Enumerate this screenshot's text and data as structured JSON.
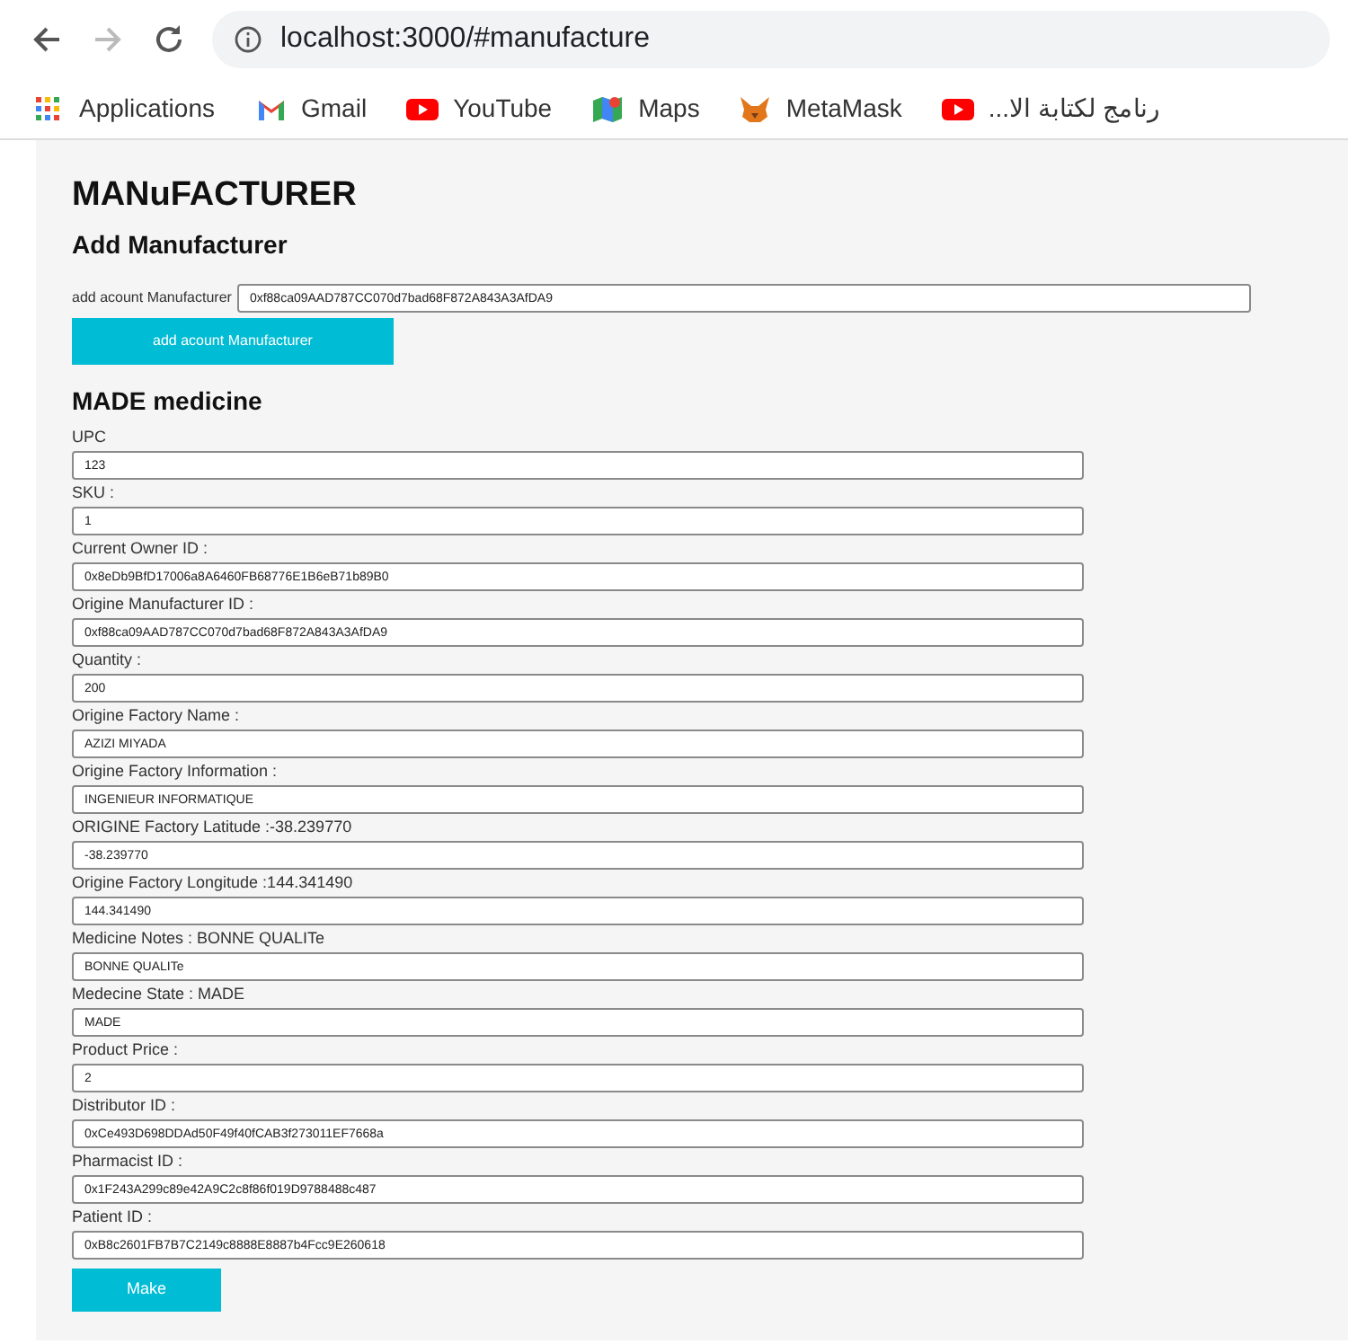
{
  "browser": {
    "url": "localhost:3000/#manufacture",
    "back_enabled": true,
    "forward_enabled": false
  },
  "bookmarks": [
    {
      "kind": "apps",
      "label": "Applications"
    },
    {
      "kind": "gmail",
      "label": "Gmail"
    },
    {
      "kind": "youtube",
      "label": "YouTube"
    },
    {
      "kind": "maps",
      "label": "Maps"
    },
    {
      "kind": "fox",
      "label": "MetaMask"
    },
    {
      "kind": "youtube",
      "label": "رنامج لكتابة الا..."
    }
  ],
  "page": {
    "title": "MANuFACTURER",
    "add_section": {
      "heading": "Add Manufacturer",
      "label": "add acount Manufacturer",
      "value": "0xf88ca09AAD787CC070d7bad68F872A843A3AfDA9",
      "button": "add acount Manufacturer"
    },
    "made_section": {
      "heading": "MADE medicine",
      "fields": [
        {
          "label": "UPC",
          "value": "123"
        },
        {
          "label": "SKU :",
          "value": "1"
        },
        {
          "label": "Current Owner ID :",
          "value": "0x8eDb9BfD17006a8A6460FB68776E1B6eB71b89B0"
        },
        {
          "label": "Origine Manufacturer ID :",
          "value": "0xf88ca09AAD787CC070d7bad68F872A843A3AfDA9"
        },
        {
          "label": "Quantity :",
          "value": "200"
        },
        {
          "label": "Origine Factory Name :",
          "value": "AZIZI MIYADA"
        },
        {
          "label": "Origine Factory Information :",
          "value": "INGENIEUR INFORMATIQUE"
        },
        {
          "label": "ORIGINE Factory Latitude :-38.239770",
          "value": "-38.239770"
        },
        {
          "label": "Origine Factory Longitude :144.341490",
          "value": "144.341490"
        },
        {
          "label": "Medicine Notes : BONNE QUALITe",
          "value": "BONNE QUALITe"
        },
        {
          "label": "Medecine State : MADE",
          "value": "MADE"
        },
        {
          "label": "Product Price :",
          "value": "2"
        },
        {
          "label": "Distributor ID :",
          "value": "0xCe493D698DDAd50F49f40fCAB3f273011EF7668a"
        },
        {
          "label": "Pharmacist ID :",
          "value": "0x1F243A299c89e42A9C2c8f86f019D9788488c487"
        },
        {
          "label": "Patient ID :",
          "value": "0xB8c2601FB7B7C2149c8888E8887b4Fcc9E260618"
        }
      ],
      "button": "Make"
    }
  }
}
